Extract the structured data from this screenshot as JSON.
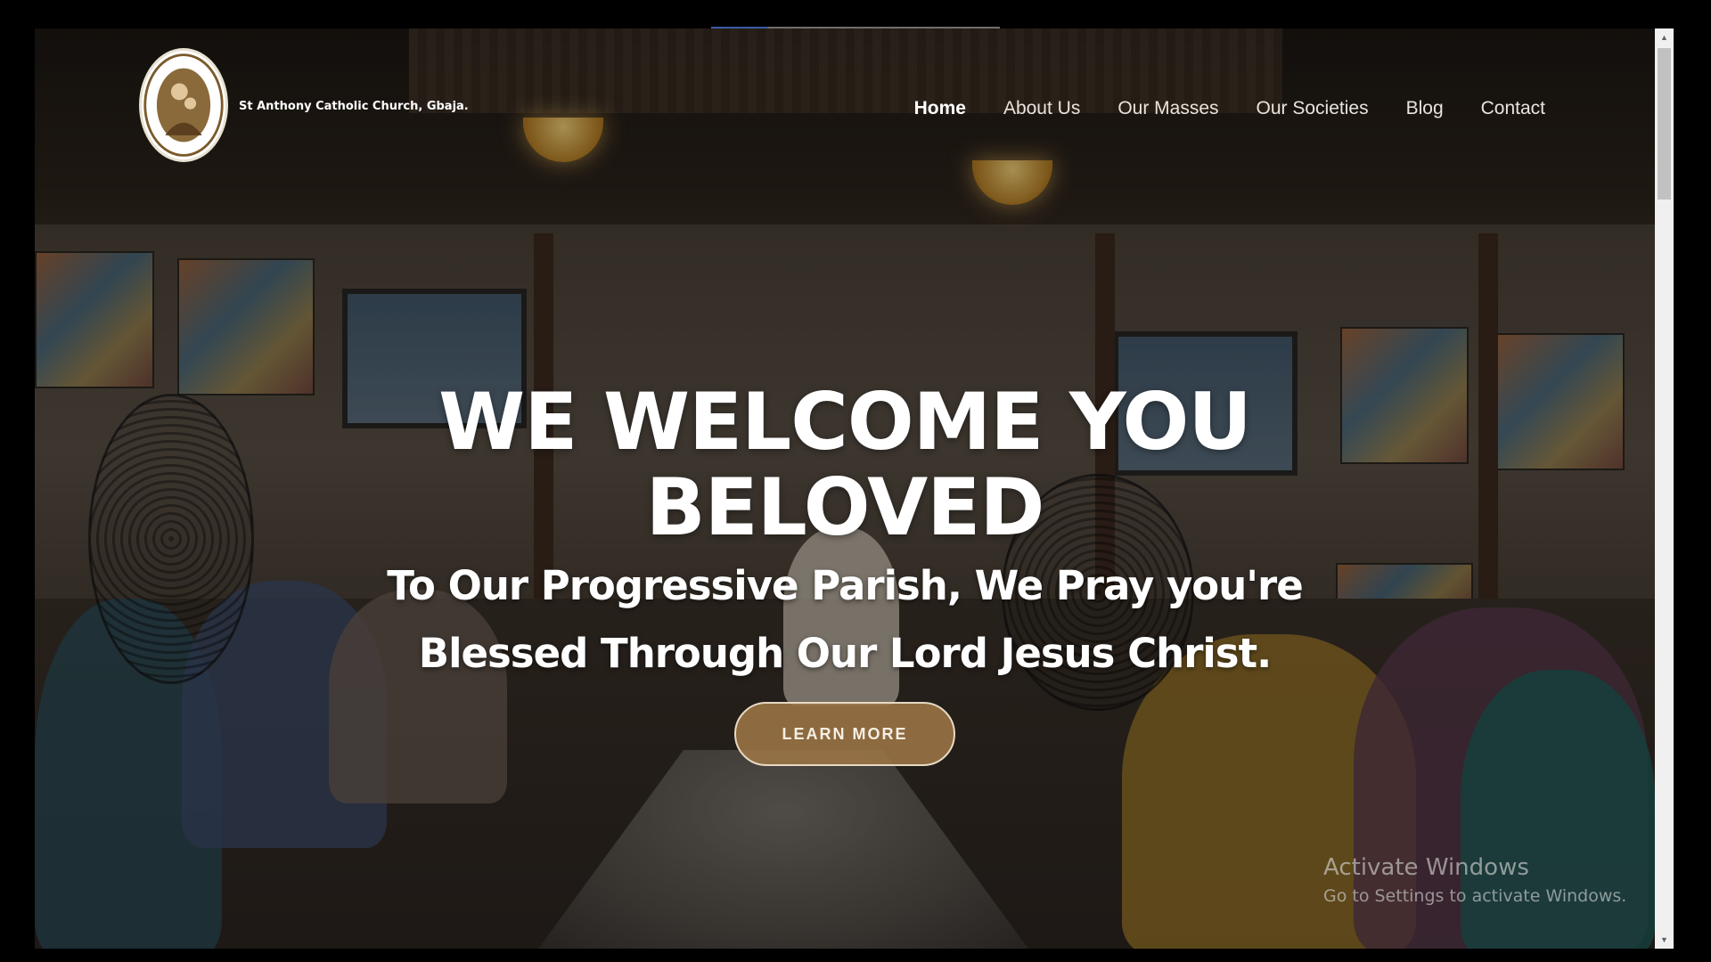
{
  "header": {
    "site_name": "St Anthony Catholic Church, Gbaja.",
    "logo_icon": "church-seal-logo"
  },
  "nav": {
    "items": [
      {
        "label": "Home",
        "active": true
      },
      {
        "label": "About Us",
        "active": false
      },
      {
        "label": "Our Masses",
        "active": false
      },
      {
        "label": "Our Societies",
        "active": false
      },
      {
        "label": "Blog",
        "active": false
      },
      {
        "label": "Contact",
        "active": false
      }
    ]
  },
  "hero": {
    "title_line1": "WE WELCOME YOU",
    "title_line2": "BELOVED",
    "subtitle_line1": "To Our Progressive Parish, We Pray you're",
    "subtitle_line2": "Blessed Through Our Lord Jesus Christ.",
    "button_label": "LEARN MORE"
  },
  "watermark": {
    "title": "Activate Windows",
    "subtitle": "Go to Settings to activate Windows."
  },
  "colors": {
    "button_bg": "#a07846",
    "button_border": "#e7d9c3",
    "text": "#ffffff"
  },
  "scrollbar": {
    "up_icon": "scroll-up-arrow-icon",
    "down_icon": "scroll-down-arrow-icon"
  }
}
